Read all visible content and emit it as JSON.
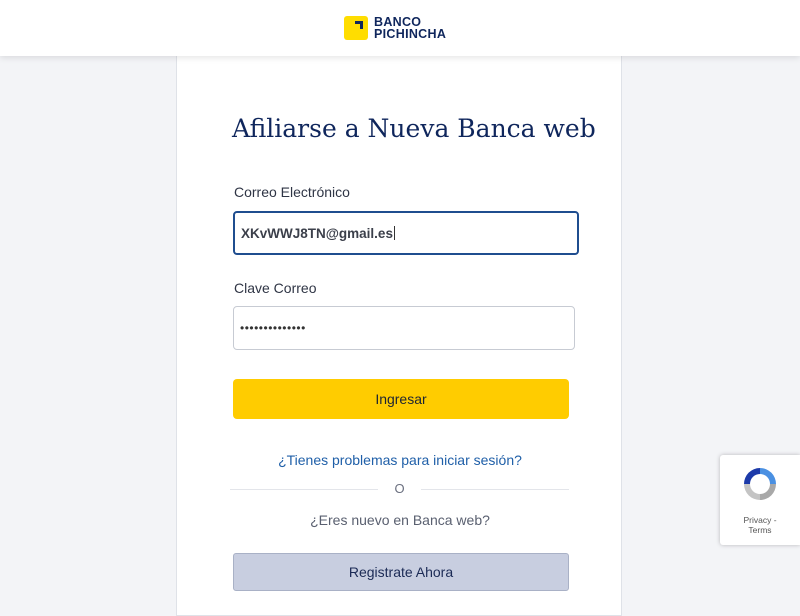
{
  "header": {
    "logo_line1": "BANCO",
    "logo_line2": "PICHINCHA"
  },
  "form": {
    "title": "Afiliarse a Nueva Banca web",
    "email_label": "Correo Electrónico",
    "email_value": "XKvWWJ8TN@gmail.es",
    "password_label": "Clave Correo",
    "password_value": "••••••••••••••",
    "submit_label": "Ingresar",
    "help_link": "¿Tienes problemas para iniciar sesión?",
    "divider_text": "O",
    "new_user_text": "¿Eres nuevo en Banca web?",
    "register_label": "Registrate Ahora"
  },
  "recaptcha": {
    "privacy": "Privacy",
    "separator": "-",
    "terms": "Terms"
  },
  "colors": {
    "brand_yellow": "#ffcc00",
    "brand_navy": "#0f265c",
    "link_blue": "#1f5fa8",
    "secondary_button": "#c8cee0"
  },
  "icons": {
    "logo": "banco-pichincha-logo-icon",
    "recaptcha": "recaptcha-icon"
  }
}
